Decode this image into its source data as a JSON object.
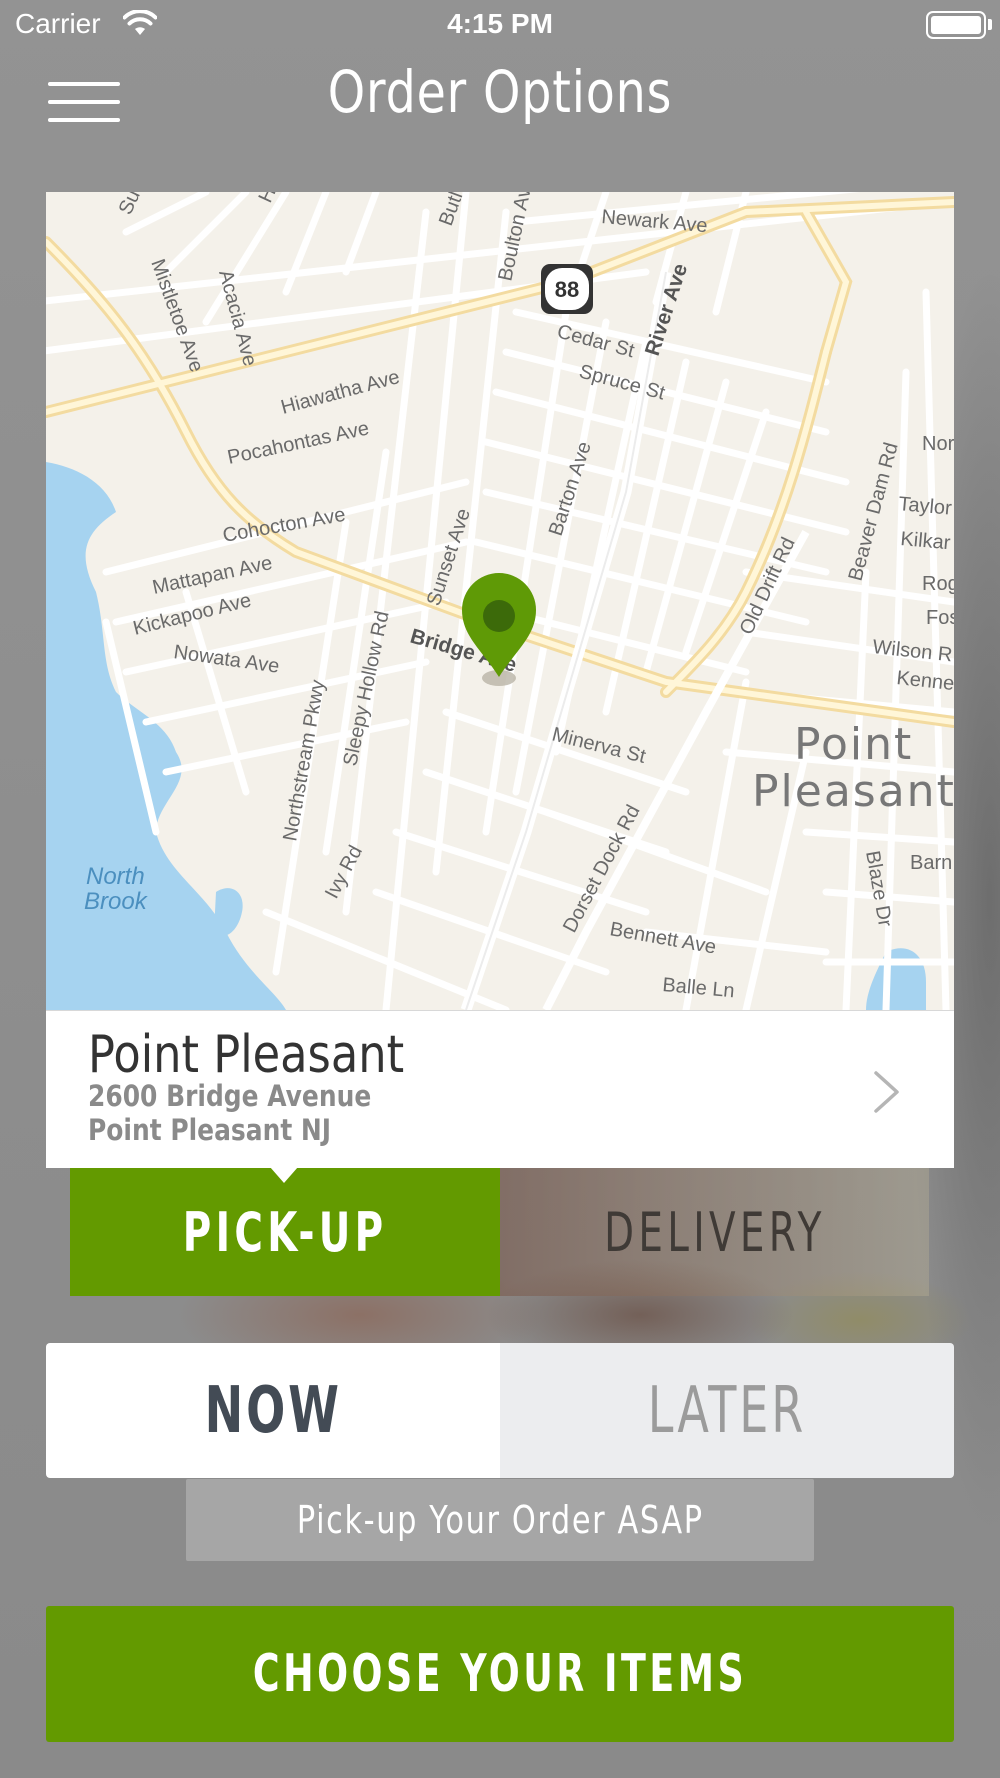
{
  "status_bar": {
    "carrier": "Carrier",
    "time": "4:15 PM"
  },
  "nav": {
    "title": "Order Options",
    "menu_icon": "hamburger-menu-icon"
  },
  "map": {
    "route_shield": "88",
    "town_label": [
      "Point",
      "Pleasant"
    ],
    "water_label": [
      "North",
      "Brook"
    ],
    "streets": {
      "newark": "Newark Ave",
      "boulton": "Boulton Av",
      "butler": "Butl",
      "mistletoe": "Mistletoe Ave",
      "acacia": "Acacia Ave",
      "su": "Su",
      "h": "H",
      "hiawatha": "Hiawatha Ave",
      "pocahontas": "Pocahontas Ave",
      "cedar": "Cedar St",
      "spruce": "Spruce St",
      "river": "River Ave",
      "barton": "Barton Ave",
      "cohocton": "Cohocton Ave",
      "mattapan": "Mattapan Ave",
      "kickapoo": "Kickapoo Ave",
      "nowata": "Nowata Ave",
      "sunset": "Sunset Ave",
      "sleepy": "Sleepy Hollow Rd",
      "northstream": "Northstream Pkwy",
      "bridge": "Bridge Ave",
      "minerva": "Minerva St",
      "old_drift": "Old Drift Rd",
      "beaver_dam": "Beaver Dam Rd",
      "nor": "Nor",
      "taylor": "Taylor",
      "kilkar": "Kilkar",
      "rog": "Rog",
      "fos": "Fos",
      "wilson": "Wilson R",
      "kenne": "Kenne",
      "ivy": "Ivy Rd",
      "dorset": "Dorset Dock Rd",
      "bennett": "Bennett Ave",
      "balle": "Balle Ln",
      "blaze": "Blaze Dr",
      "barn": "Barn"
    },
    "colors": {
      "land": "#f4f1ea",
      "water": "#a6d3f0",
      "major_road": "#fbe3a4",
      "pin": "#5f9a06"
    }
  },
  "location": {
    "name": "Point Pleasant",
    "address_line1": "2600 Bridge Avenue",
    "address_line2": "Point Pleasant NJ"
  },
  "order_method": {
    "pickup_label": "PICK-UP",
    "delivery_label": "DELIVERY",
    "selected": "PICK-UP"
  },
  "order_time": {
    "now_label": "NOW",
    "later_label": "LATER",
    "selected": "NOW",
    "hint": "Pick-up Your Order ASAP"
  },
  "cta": {
    "label": "CHOOSE YOUR ITEMS"
  },
  "colors": {
    "accent_green": "#639a00",
    "background": "#8f8f8f"
  }
}
